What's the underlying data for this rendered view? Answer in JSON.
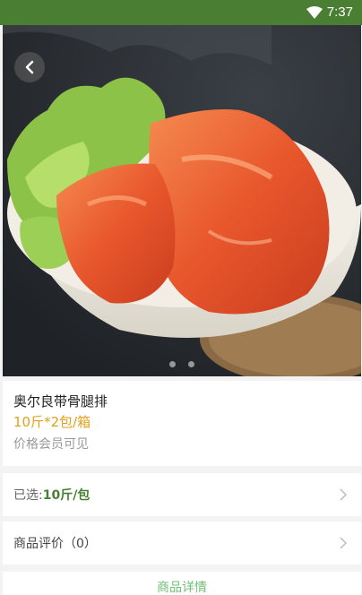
{
  "status_bar": {
    "time": "7:37",
    "wifi_icon": "wifi-icon"
  },
  "hero": {
    "image_icon": "food-photo",
    "back_icon": "chevron-left-icon",
    "page_count": 2,
    "active_page": 1
  },
  "product": {
    "name": "奥尔良带骨腿排",
    "spec": "10斤*2包/箱",
    "price_note": "价格会员可见"
  },
  "selection": {
    "label": "已选:",
    "value": "10斤/包"
  },
  "reviews": {
    "label": "商品评价（0）"
  },
  "detail_tab": {
    "label": "商品详情"
  },
  "colors": {
    "accent": "#4a7f33",
    "spec": "#e4a01a",
    "tab": "#6fbf73"
  }
}
